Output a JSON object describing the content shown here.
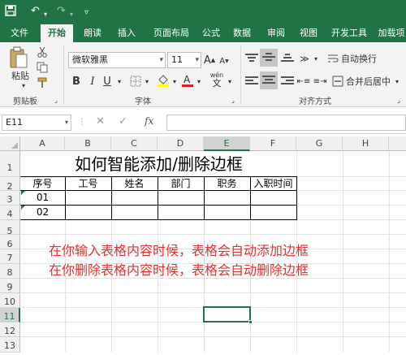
{
  "tabs": [
    "文件",
    "开始",
    "朗读",
    "插入",
    "页面布局",
    "公式",
    "数据",
    "审阅",
    "视图",
    "开发工具",
    "加载项"
  ],
  "ribbon": {
    "paste_label": "粘贴",
    "clipboard_group": "剪贴板",
    "font_group": "字体",
    "align_group": "对齐方式",
    "font_name": "微软雅黑",
    "font_size": "11",
    "grow_font": "A",
    "shrink_font": "A",
    "bold": "B",
    "italic": "I",
    "underline": "U",
    "wrap_text": "自动换行",
    "merge_center": "合并后居中",
    "wen": "wén",
    "wen_char": "文"
  },
  "formula_bar": {
    "name_box": "E11",
    "fx": "fx",
    "value": ""
  },
  "grid": {
    "columns": [
      "A",
      "B",
      "C",
      "D",
      "E",
      "F",
      "G",
      "H"
    ],
    "rows": [
      "1",
      "2",
      "3",
      "4",
      "5",
      "6",
      "7",
      "8",
      "9",
      "10",
      "11",
      "12",
      "13"
    ],
    "selected_column": "E",
    "selected_row": "11"
  },
  "table": {
    "title": "如何智能添加/删除边框",
    "headers": [
      "序号",
      "工号",
      "姓名",
      "部门",
      "职务",
      "入职时间"
    ],
    "rows": [
      [
        "01"
      ],
      [
        "02"
      ]
    ]
  },
  "notes": {
    "line1": "在你输入表格内容时候，表格会自动添加边框",
    "line2": "在你删除表格内容时候，表格会自动删除边框"
  },
  "colors": {
    "accent": "#217346",
    "note": "#e03030"
  }
}
